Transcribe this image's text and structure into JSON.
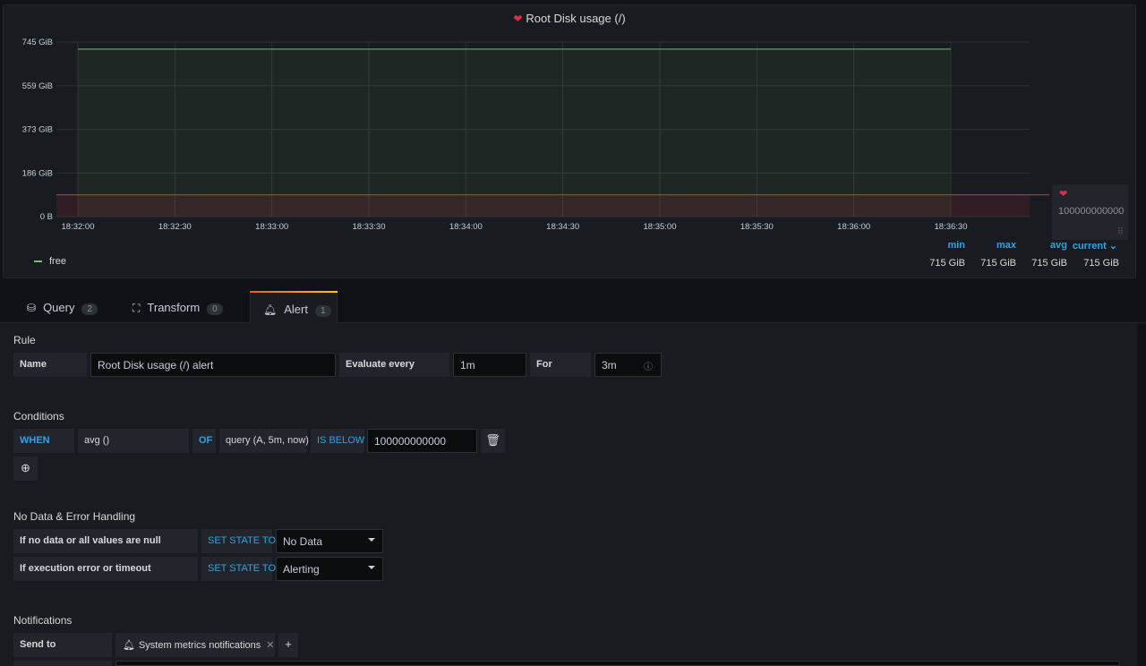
{
  "panel": {
    "title": "Root Disk usage (/)",
    "heart_icon": "heart-broken-icon"
  },
  "chart_data": {
    "type": "area",
    "x": [
      "18:32:00",
      "18:32:30",
      "18:33:00",
      "18:33:30",
      "18:34:00",
      "18:34:30",
      "18:35:00",
      "18:35:30",
      "18:36:00",
      "18:36:30"
    ],
    "y_ticks": [
      "745 GiB",
      "559 GiB",
      "373 GiB",
      "186 GiB",
      "0 B"
    ],
    "ylim": [
      0,
      745
    ],
    "series": [
      {
        "name": "free",
        "values": [
          715,
          715,
          715,
          715,
          715,
          715,
          715,
          715,
          715,
          715
        ],
        "color": "#73bf69"
      }
    ],
    "threshold": {
      "value": 100000000000,
      "label": "100000000000",
      "color": "#e02f44"
    },
    "legend": {
      "headers": {
        "min": "min",
        "max": "max",
        "avg": "avg",
        "current": "current ⌄"
      },
      "values": {
        "min": "715 GiB",
        "max": "715 GiB",
        "avg": "715 GiB",
        "current": "715 GiB"
      }
    },
    "grid": true
  },
  "tabs": [
    {
      "label": "Query",
      "count": "2",
      "icon": "database-icon"
    },
    {
      "label": "Transform",
      "count": "0",
      "icon": "transform-icon"
    },
    {
      "label": "Alert",
      "count": "1",
      "icon": "bell-icon"
    }
  ],
  "rule": {
    "heading": "Rule",
    "name_label": "Name",
    "name_value": "Root Disk usage (/) alert",
    "evaluate_label": "Evaluate every",
    "evaluate_value": "1m",
    "for_label": "For",
    "for_value": "3m"
  },
  "conditions": {
    "heading": "Conditions",
    "when": "WHEN",
    "reducer": "avg ()",
    "of": "OF",
    "query": "query (A, 5m, now)",
    "evaluator": "IS BELOW",
    "threshold": "100000000000"
  },
  "nodata": {
    "heading": "No Data & Error Handling",
    "row1_label": "If no data or all values are null",
    "row1_kw": "SET STATE TO",
    "row1_value": "No Data",
    "row2_label": "If execution error or timeout",
    "row2_kw": "SET STATE TO",
    "row2_value": "Alerting"
  },
  "notifications": {
    "heading": "Notifications",
    "send_to_label": "Send to",
    "channel": "System metrics notifications"
  }
}
